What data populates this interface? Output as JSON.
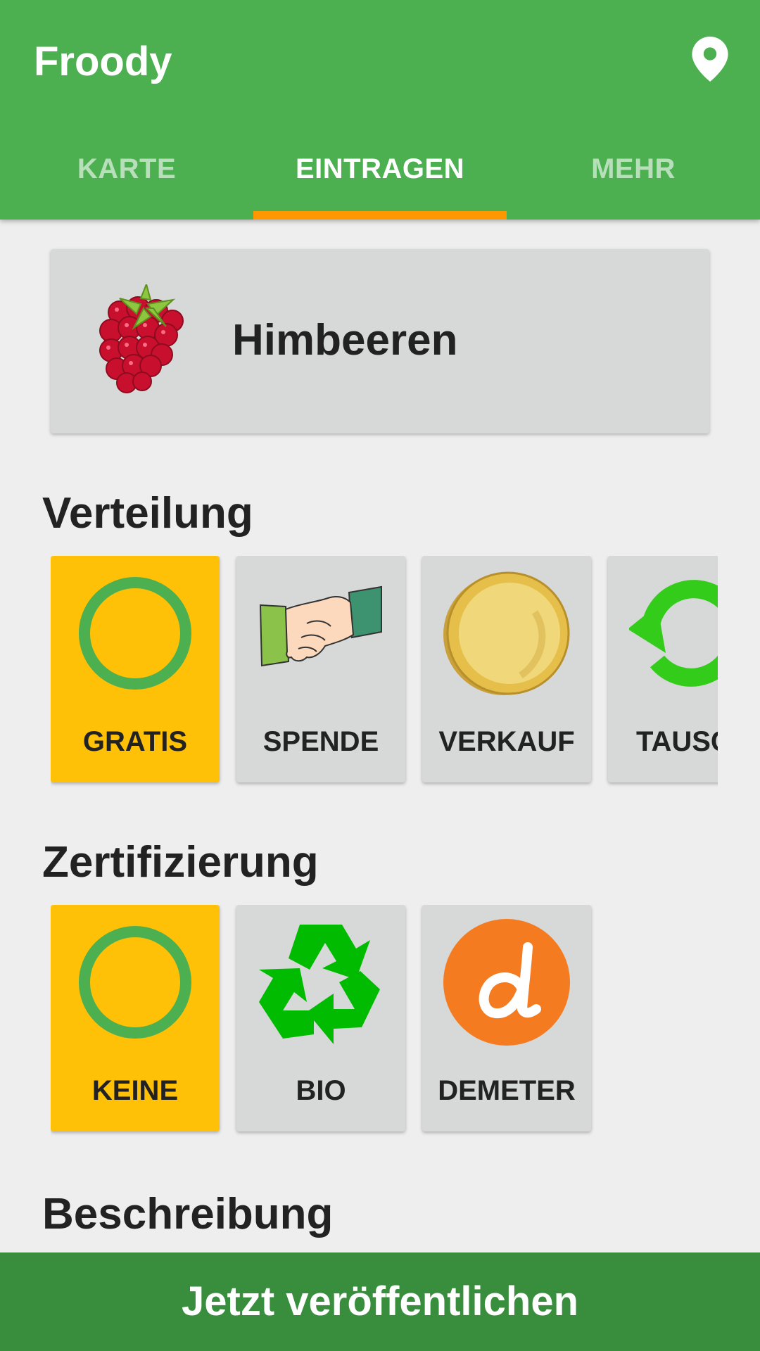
{
  "app": {
    "title": "Froody",
    "location_icon": "location-pin-icon"
  },
  "tabs": [
    {
      "label": "KARTE",
      "active": false
    },
    {
      "label": "EINTRAGEN",
      "active": true
    },
    {
      "label": "MEHR",
      "active": false
    }
  ],
  "product": {
    "name": "Himbeeren",
    "icon": "raspberry-icon"
  },
  "sections": {
    "distribution": {
      "title": "Verteilung",
      "options": [
        {
          "label": "GRATIS",
          "icon": "ring-icon",
          "selected": true
        },
        {
          "label": "SPENDE",
          "icon": "handshake-icon",
          "selected": false
        },
        {
          "label": "VERKAUF",
          "icon": "coin-icon",
          "selected": false
        },
        {
          "label": "TAUSC",
          "icon": "exchange-arrows-icon",
          "selected": false
        }
      ]
    },
    "certification": {
      "title": "Zertifizierung",
      "options": [
        {
          "label": "KEINE",
          "icon": "ring-icon",
          "selected": true
        },
        {
          "label": "BIO",
          "icon": "recycle-icon",
          "selected": false
        },
        {
          "label": "DEMETER",
          "icon": "demeter-logo-icon",
          "selected": false
        }
      ]
    },
    "description": {
      "title": "Beschreibung"
    }
  },
  "publish_button": "Jetzt veröffentlichen",
  "colors": {
    "primary": "#4caf50",
    "primary_dark": "#388e3c",
    "accent": "#ff9800",
    "selected": "#ffc107",
    "card": "#d7d8d8",
    "background": "#eeeeee"
  }
}
